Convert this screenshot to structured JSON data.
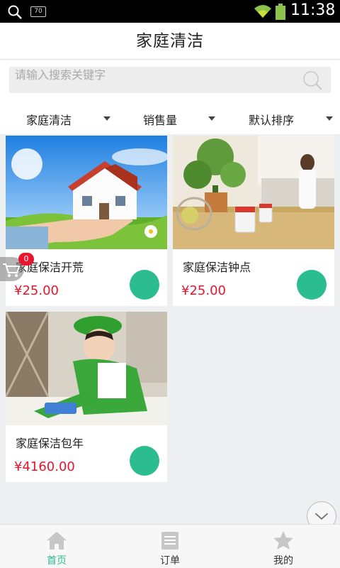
{
  "status_bar": {
    "time": "11:38",
    "notification_badge": "70"
  },
  "header": {
    "title": "家庭清洁"
  },
  "search": {
    "placeholder": "请输入搜索关键字"
  },
  "filters": [
    {
      "label": "家庭清洁"
    },
    {
      "label": "销售量"
    },
    {
      "label": "默认排序"
    }
  ],
  "products": [
    {
      "name": "家庭保洁开荒",
      "price": "¥25.00",
      "image": "house-in-hands"
    },
    {
      "name": "家庭保洁钟点",
      "price": "¥25.00",
      "image": "kitchen-plant"
    },
    {
      "name": "家庭保洁包年",
      "price": "¥4160.00",
      "image": "cleaner-green-uniform"
    }
  ],
  "cart": {
    "count": "0"
  },
  "bottom_nav": [
    {
      "label": "首页",
      "icon": "home-icon",
      "active": true
    },
    {
      "label": "订单",
      "icon": "order-icon",
      "active": false
    },
    {
      "label": "我的",
      "icon": "star-icon",
      "active": false
    }
  ],
  "colors": {
    "accent": "#2bbd8f",
    "price": "#e8152f",
    "badge": "#e8152f"
  }
}
